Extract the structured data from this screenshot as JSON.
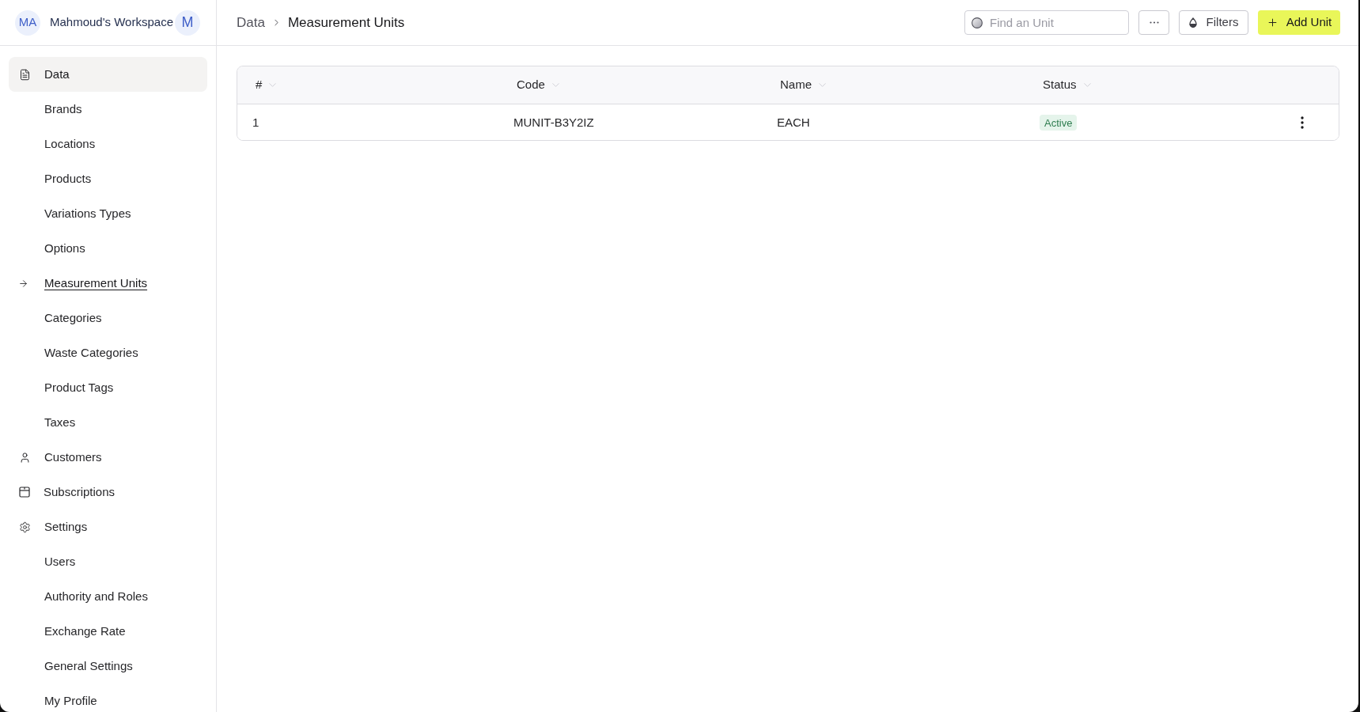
{
  "sidebar": {
    "workspace": {
      "initials": "MA",
      "name": "Mahmoud's Workspace",
      "user_initial": "M"
    },
    "items": [
      {
        "label": "Data",
        "selected": true,
        "children": [
          {
            "label": "Brands",
            "selected": false
          },
          {
            "label": "Locations",
            "selected": false
          },
          {
            "label": "Products",
            "selected": false
          },
          {
            "label": "Variations Types",
            "selected": false
          },
          {
            "label": "Options",
            "selected": false
          },
          {
            "label": "Measurement Units",
            "selected": true
          },
          {
            "label": "Categories",
            "selected": false
          },
          {
            "label": "Waste Categories",
            "selected": false
          },
          {
            "label": "Product Tags",
            "selected": false
          },
          {
            "label": "Taxes",
            "selected": false
          }
        ]
      },
      {
        "label": "Customers",
        "selected": false
      },
      {
        "label": "Subscriptions",
        "selected": false
      },
      {
        "label": "Settings",
        "selected": false,
        "children": [
          {
            "label": "Users",
            "selected": false
          },
          {
            "label": "Authority and Roles",
            "selected": false
          },
          {
            "label": "Exchange Rate",
            "selected": false
          },
          {
            "label": "General Settings",
            "selected": false
          },
          {
            "label": "My Profile",
            "selected": false
          }
        ]
      }
    ]
  },
  "header": {
    "breadcrumb": [
      "Data",
      "Measurement Units"
    ],
    "search": {
      "placeholder": "Find an Unit"
    },
    "buttons": [
      {
        "kind": "more"
      },
      {
        "kind": "filter",
        "label": "Filters"
      },
      {
        "kind": "add",
        "label": "Add Unit"
      }
    ]
  },
  "table": {
    "columns": [
      "#",
      "Code",
      "Name",
      "Status"
    ],
    "rows": [
      {
        "number": "1",
        "code": "MUNIT-B3Y2IZ",
        "name": "EACH",
        "status": "Active"
      }
    ]
  }
}
